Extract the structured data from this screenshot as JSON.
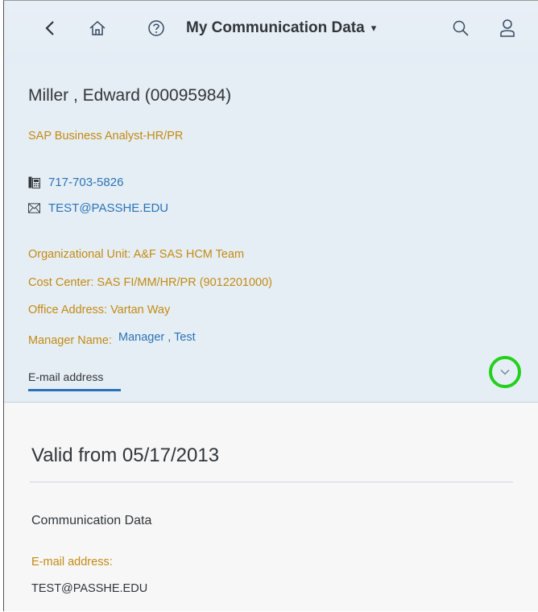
{
  "shell": {
    "title": "My Communication Data",
    "title_caret": "▾",
    "back_icon": "chevron-left-icon",
    "home_icon": "home-icon",
    "help_icon": "help-icon",
    "search_icon": "search-icon",
    "user_icon": "user-icon"
  },
  "employee": {
    "name": "Miller , Edward (00095984)",
    "role": "SAP Business Analyst-HR/PR",
    "phone": "717-703-5826",
    "email": "TEST@PASSHE.EDU"
  },
  "attributes": {
    "org_unit": "Organizational Unit: A&F SAS HCM Team",
    "cost_center": "Cost Center: SAS FI/MM/HR/PR (9012201000)",
    "office_address": "Office Address: Vartan Way",
    "manager_label": "Manager Name:",
    "manager_value": "Manager , Test"
  },
  "tabs": {
    "email_tab": "E-mail address"
  },
  "content": {
    "valid_from": "Valid from 05/17/2013",
    "section_title": "Communication Data",
    "email_label": "E-mail address:",
    "email_value": "TEST@PASSHE.EDU"
  },
  "colors": {
    "accent": "#2a73b8",
    "label": "#c38a12",
    "highlight_circle": "#22d11e"
  }
}
